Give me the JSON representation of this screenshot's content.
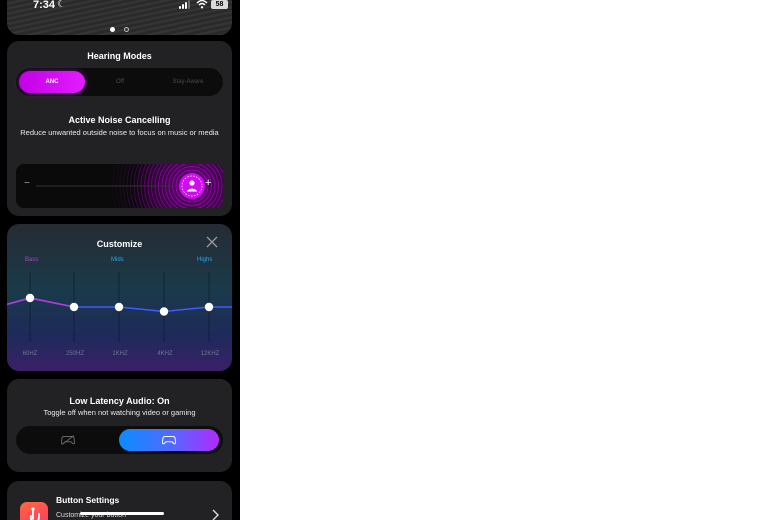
{
  "status_bar": {
    "time": "7:34",
    "battery": "58",
    "icons": [
      "moon-icon",
      "signal-icon",
      "wifi-icon",
      "battery-icon"
    ]
  },
  "pager": {
    "current": 1,
    "total": 2
  },
  "hearing_modes": {
    "title": "Hearing Modes",
    "options": [
      {
        "label": "ANC",
        "selected": true
      },
      {
        "label": "Off",
        "selected": false
      },
      {
        "label": "Stay-Aware",
        "selected": false
      }
    ],
    "active_title": "Active Noise Cancelling",
    "active_description": "Reduce unwanted outside noise to focus on music or media",
    "slider": {
      "minus": "−",
      "plus": "+",
      "level": 0.96
    }
  },
  "customize": {
    "title": "Customize",
    "bands": [
      {
        "label": "Bass",
        "color": "#b23bd6"
      },
      {
        "label": "Mids",
        "color": "#2fa7e6"
      },
      {
        "label": "Highs",
        "color": "#2fa7e6"
      }
    ],
    "frequencies": [
      "60HZ",
      "250HZ",
      "1KHZ",
      "4KHZ",
      "12KHZ"
    ],
    "gains": [
      2,
      0,
      0,
      -1,
      0
    ]
  },
  "low_latency": {
    "title": "Low Latency Audio: On",
    "description": "Toggle off when not watching video or gaming",
    "enabled": true
  },
  "button_settings": {
    "title": "Button Settings",
    "subtitle": "Customize your button"
  },
  "colors": {
    "accent_magenta": "#d10cf2",
    "accent_blue": "#0a8dff",
    "card": "#222224",
    "background": "#000000"
  }
}
